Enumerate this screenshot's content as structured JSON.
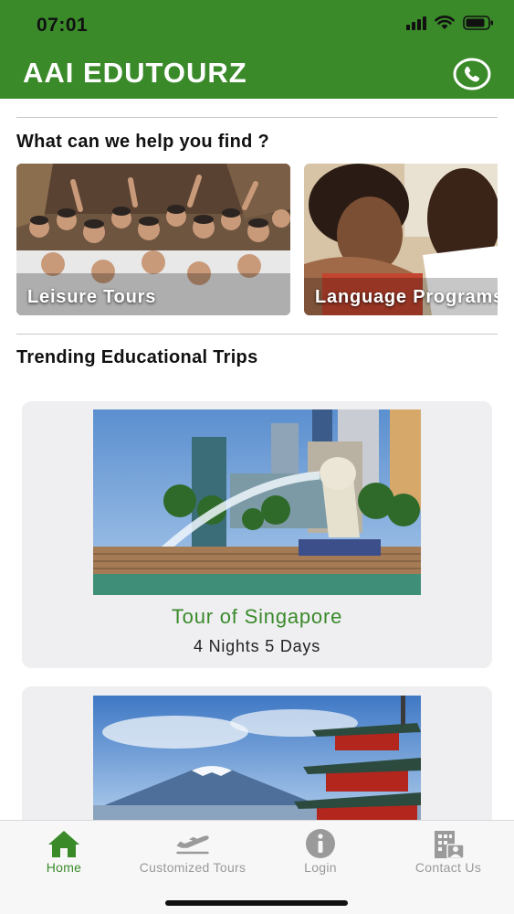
{
  "status_bar": {
    "time": "07:01"
  },
  "header": {
    "title": "AAI EDUTOURZ",
    "phone_icon": "phone-icon"
  },
  "help_section": {
    "title": "What can we help you find ?",
    "categories": [
      {
        "label": "Leisure Tours"
      },
      {
        "label": "Language Programs"
      }
    ]
  },
  "trending": {
    "title": "Trending Educational Trips",
    "trips": [
      {
        "name": "Tour of Singapore",
        "duration": "4 Nights 5 Days"
      }
    ]
  },
  "tabs": [
    {
      "label": "Home",
      "icon": "home-icon",
      "active": true
    },
    {
      "label": "Customized Tours",
      "icon": "airplane-icon",
      "active": false
    },
    {
      "label": "Login",
      "icon": "info-icon",
      "active": false
    },
    {
      "label": "Contact Us",
      "icon": "building-contact-icon",
      "active": false
    }
  ],
  "colors": {
    "brand_green": "#3a8a2a",
    "card_bg": "#efeff2",
    "tab_inactive": "#9a9a9a"
  }
}
